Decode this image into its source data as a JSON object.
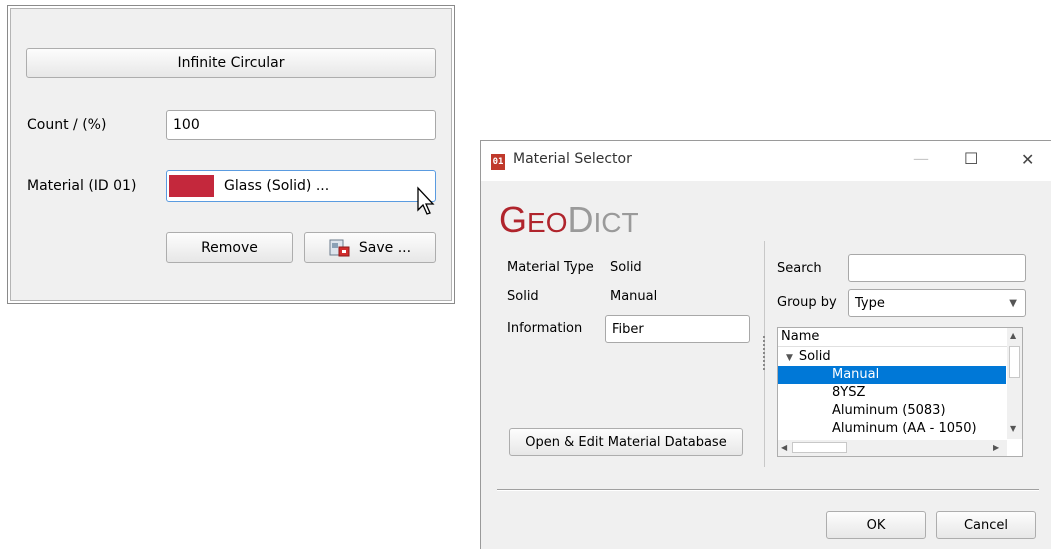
{
  "left_panel": {
    "shape_button_label": "Infinite Circular",
    "count_label": "Count / (%)",
    "count_value": "100",
    "material_label": "Material (ID 01)",
    "material_value": "Glass (Solid) ...",
    "material_color": "#c4283c",
    "remove_label": "Remove",
    "save_label": "Save ..."
  },
  "dialog": {
    "title": "Material Selector",
    "app_icon_text": "01",
    "logo_text": "GeoDict",
    "window_buttons": {
      "minimize": "—",
      "maximize": "☐",
      "close": "✕"
    },
    "material_type_label": "Material Type",
    "material_type_value": "Solid",
    "solid_label": "Solid",
    "solid_value": "Manual",
    "information_label": "Information",
    "information_value": "Fiber",
    "open_db_label": "Open & Edit Material Database",
    "search_label": "Search",
    "search_value": "",
    "group_by_label": "Group by",
    "group_by_value": "Type",
    "tree_header": "Name",
    "tree_items": [
      {
        "label": "Solid",
        "level": 0,
        "expanded": true
      },
      {
        "label": "Manual",
        "level": 1,
        "selected": true
      },
      {
        "label": "8YSZ",
        "level": 1
      },
      {
        "label": "Aluminum (5083)",
        "level": 1
      },
      {
        "label": "Aluminum (AA - 1050)",
        "level": 1
      }
    ],
    "ok_label": "OK",
    "cancel_label": "Cancel",
    "accent_color": "#0078d7",
    "logo_color": "#b0242c"
  }
}
